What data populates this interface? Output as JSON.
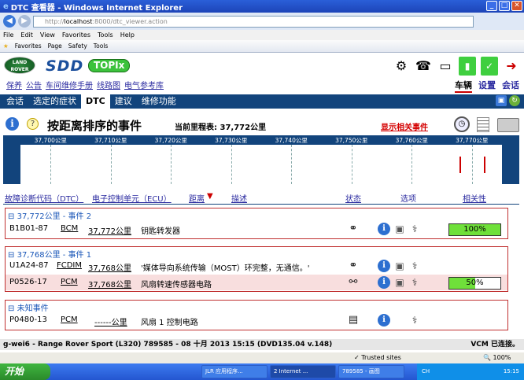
{
  "window": {
    "title": "DTC 查看器 - Windows Internet Explorer",
    "min": "_",
    "max": "□",
    "close": "✕"
  },
  "addressbar": {
    "url_prefix": "http://",
    "url_host": "localhost",
    "url_rest": ":8000/dtc_viewer.action"
  },
  "menubar": [
    "File",
    "Edit",
    "View",
    "Favorites",
    "Tools",
    "Help"
  ],
  "favbar": {
    "favorites": "Favorites",
    "page": "Page",
    "safety": "Safety",
    "tools": "Tools"
  },
  "app": {
    "logo": "LAND ROVER",
    "sdd": "SDD",
    "topix": "TOPIx",
    "links": [
      "保养",
      "公告",
      "车间维修手册",
      "线路图",
      "电气参考库"
    ],
    "main_tabs": [
      "车辆",
      "设置",
      "会话"
    ],
    "nav_tabs": [
      "会话",
      "选定的症状",
      "DTC",
      "建议",
      "维修功能"
    ],
    "active_nav_tab": "DTC"
  },
  "header": {
    "title": "按距离排序的事件",
    "mileage": "当前里程表: 37,772公里",
    "related": "显示相关事件"
  },
  "timeline": {
    "ticks": [
      "37,700公里",
      "37,710公里",
      "37,720公里",
      "37,730公里",
      "37,740公里",
      "37,750公里",
      "37,760公里",
      "37,770公里"
    ]
  },
  "chart_data": {
    "type": "scatter",
    "title": "",
    "xlabel": "",
    "ylabel": "",
    "xlim": [
      37695,
      37775
    ],
    "x_ticks": [
      37700,
      37710,
      37720,
      37730,
      37740,
      37750,
      37760,
      37770
    ],
    "events_km": [
      37768,
      37772
    ]
  },
  "columns": {
    "code": "故障诊断代码（DTC）",
    "ecu": "电子控制单元（ECU）",
    "distance": "距离",
    "description": "描述",
    "status": "状态",
    "options": "选项",
    "relevance": "相关性"
  },
  "groups": [
    {
      "title": "37,772公里 - 事件 2",
      "rows": [
        {
          "code": "B1B01-87",
          "ecu": "BCM",
          "distance": "37,772公里",
          "description": "钥匙转发器",
          "relevance": "100%",
          "relevance_value": 1.0,
          "highlight": false
        }
      ]
    },
    {
      "title": "37,768公里 - 事件 1",
      "rows": [
        {
          "code": "U1A24-87",
          "ecu": "FCDIM",
          "distance": "37,768公里",
          "description": "'媒体导向系统传输（MOST）环完整，无通信。'",
          "relevance": "",
          "relevance_value": null,
          "highlight": false
        },
        {
          "code": "P0526-17",
          "ecu": "PCM",
          "distance": "37,768公里",
          "description": "风扇转速传感器电路",
          "relevance": "50%",
          "relevance_value": 0.5,
          "highlight": true
        }
      ]
    },
    {
      "title": "未知事件",
      "rows": [
        {
          "code": "P0480-13",
          "ecu": "PCM",
          "distance": "------公里",
          "description": "风扇 1 控制电路",
          "relevance": "",
          "relevance_value": null,
          "highlight": false
        }
      ]
    }
  ],
  "statusline": {
    "vehicle": "g-wei6 - Range Rover Sport (L320) 789585 - 08 十月 2013 15:15 (DVD135.04 v.148)",
    "vcm": "VCM 已连接。"
  },
  "iestatus": {
    "trusted": "Trusted sites",
    "zoom": "100%"
  },
  "taskbar": {
    "start": "开始",
    "tasks": [
      "JLR 应用程序...",
      "2 Internet ...",
      "789585 - 画图"
    ],
    "lang": "CH",
    "time": "15:15"
  }
}
